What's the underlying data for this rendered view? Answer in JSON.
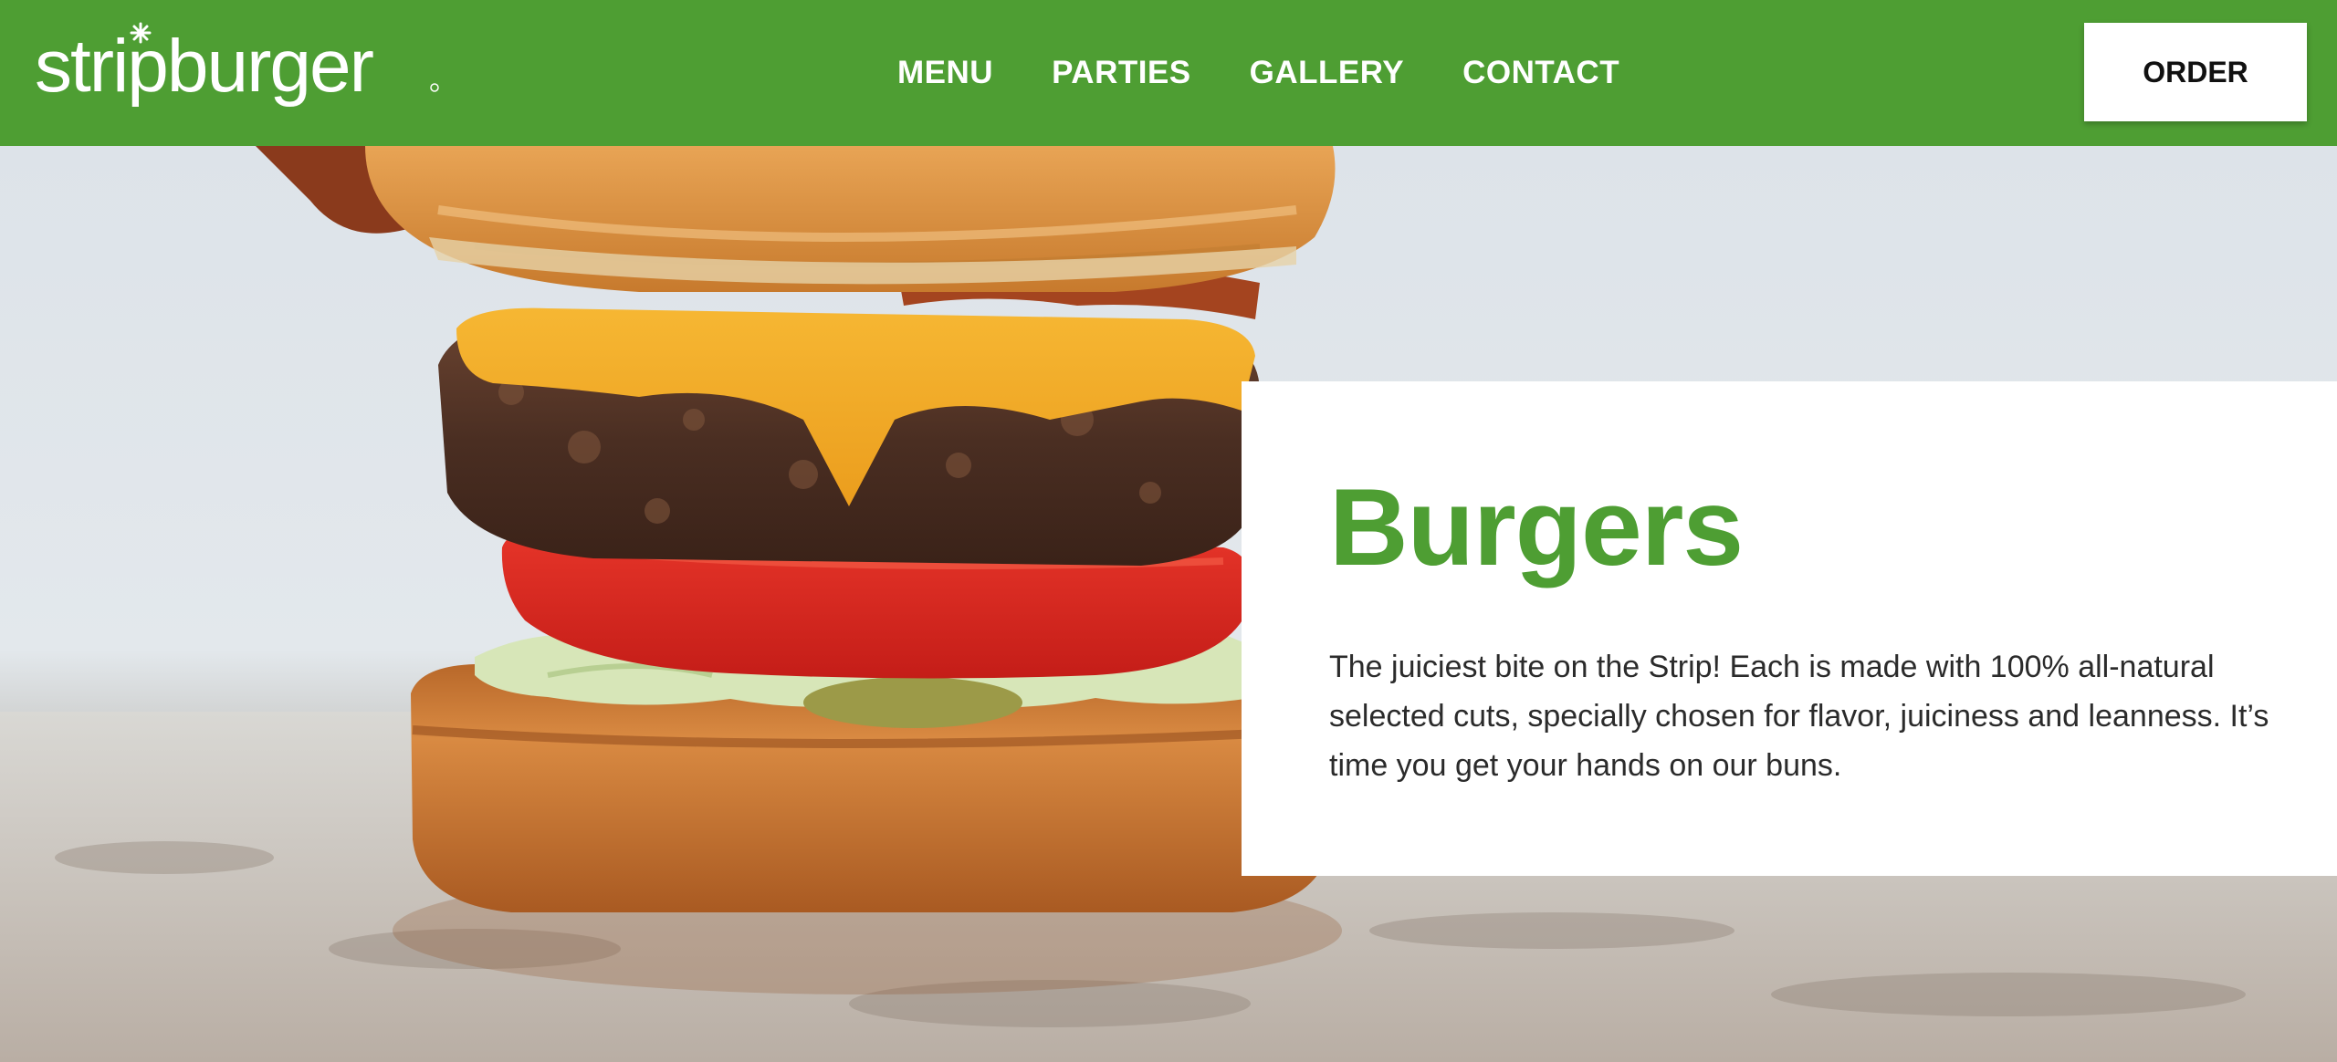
{
  "brand": {
    "name": "stripburger",
    "color_primary": "#4e9e33",
    "color_white": "#ffffff"
  },
  "nav": {
    "items": [
      {
        "label": "MENU"
      },
      {
        "label": "PARTIES"
      },
      {
        "label": "GALLERY"
      },
      {
        "label": "CONTACT"
      }
    ],
    "order_label": "ORDER"
  },
  "hero": {
    "image": "burger-photo",
    "title": "Burgers",
    "body": "The juiciest bite on the Strip! Each is made with 100% all-natural selected cuts, specially chosen for flavor, juiciness and leanness. It’s time you get your hands on our buns."
  }
}
